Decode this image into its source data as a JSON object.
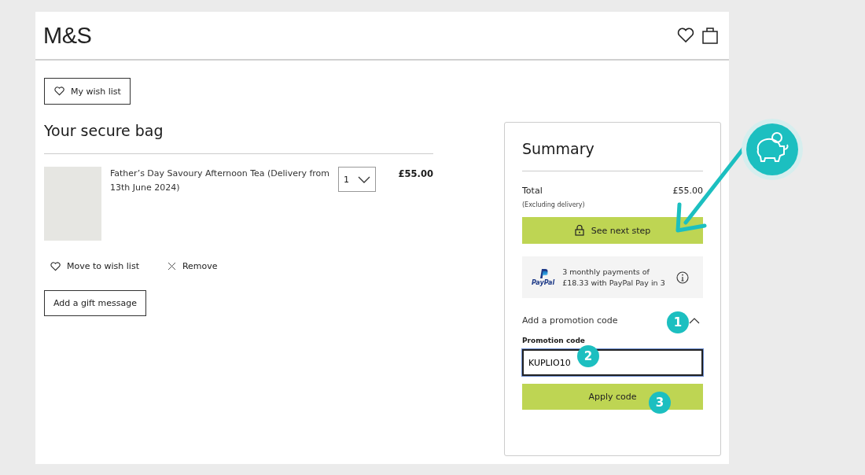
{
  "header": {
    "logo": "M&S"
  },
  "wishlist_button": "My wish list",
  "bag": {
    "title": "Your secure bag",
    "items": [
      {
        "name": "Father’s Day Savoury Afternoon Tea (Delivery from 13th June 2024)",
        "quantity": "1",
        "price": "£55.00"
      }
    ],
    "move_to_wishlist": "Move to wish list",
    "remove": "Remove",
    "gift_message_button": "Add a gift message"
  },
  "summary": {
    "title": "Summary",
    "total_label": "Total",
    "total_value": "£55.00",
    "note": "(Excluding delivery)",
    "checkout_button": "See next step",
    "paypal": {
      "logo": "PayPal",
      "lines": [
        "3 monthly payments of",
        "£18.33 with PayPal Pay in 3"
      ]
    },
    "promo": {
      "toggle": "Add a promotion code",
      "expanded": true,
      "label": "Promotion code",
      "value": "KUPLIO10",
      "apply_button": "Apply code"
    }
  },
  "annotations": [
    {
      "label": "1"
    },
    {
      "label": "2"
    },
    {
      "label": "3"
    }
  ]
}
